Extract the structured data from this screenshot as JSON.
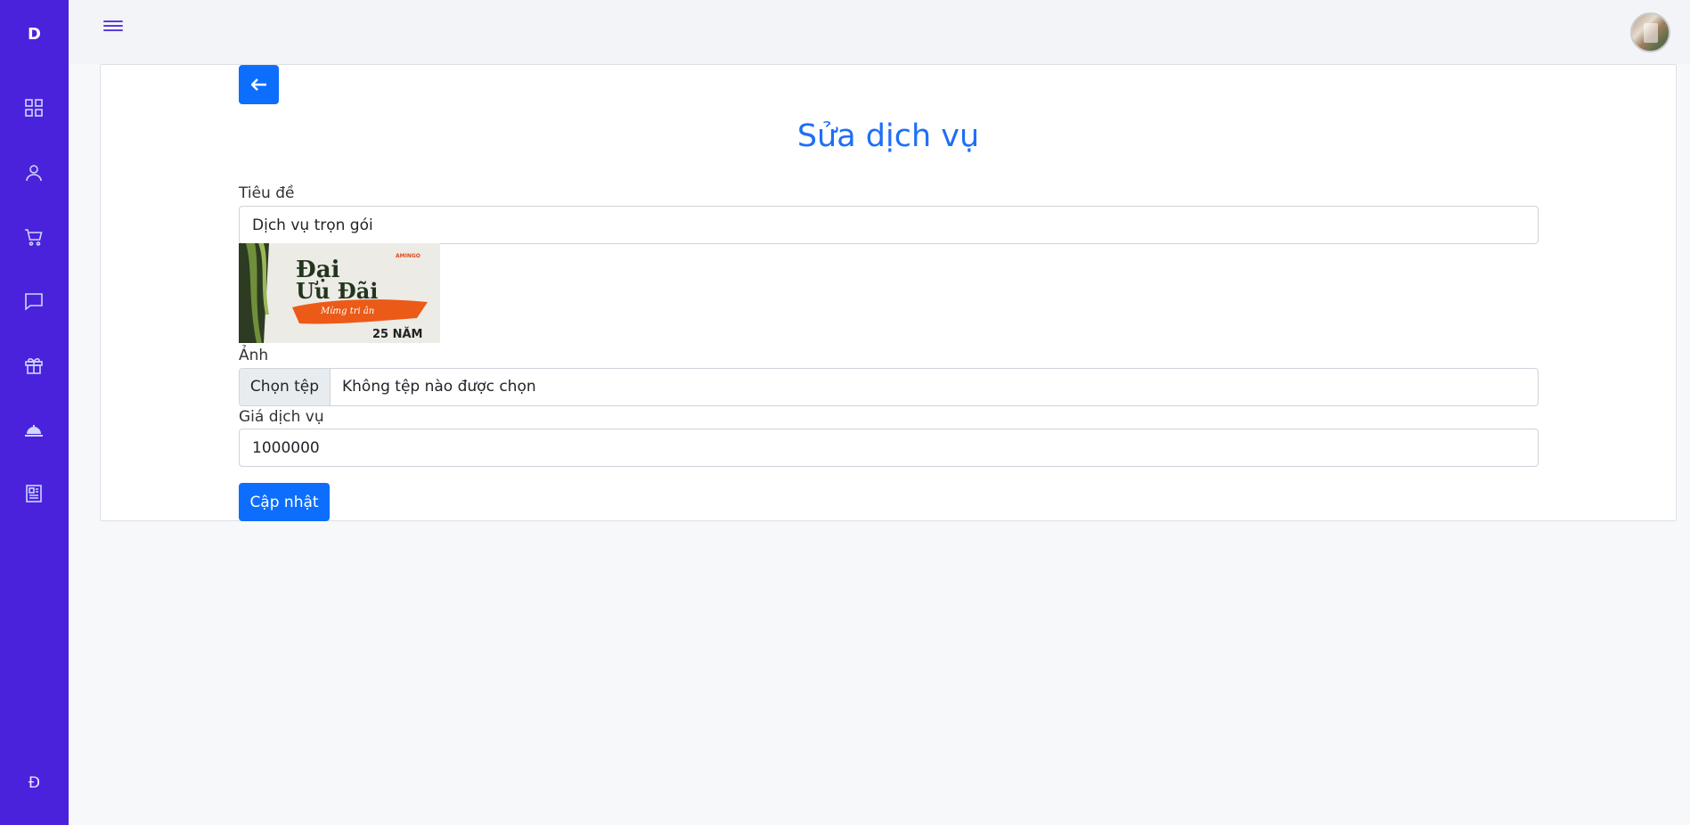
{
  "sidebar": {
    "brand": "D",
    "bottom_mark": "Đ",
    "items": [
      {
        "icon": "dashboard-grid-icon"
      },
      {
        "icon": "user-icon"
      },
      {
        "icon": "cart-icon"
      },
      {
        "icon": "message-icon"
      },
      {
        "icon": "gift-icon"
      },
      {
        "icon": "service-bell-icon"
      },
      {
        "icon": "newspaper-icon"
      }
    ]
  },
  "header": {
    "menu_icon": "hamburger-menu-icon",
    "avatar": "user-avatar"
  },
  "page": {
    "title": "Sửa dịch vụ",
    "back_icon": "arrow-left-icon"
  },
  "form": {
    "title_label": "Tiêu đề",
    "title_value": "Dịch vụ trọn gói",
    "image_label": "Ảnh",
    "image_preview_text": {
      "line1": "Đại",
      "line2": "Ưu Đãi",
      "script": "Mừng tri ân",
      "years": "25 NĂM",
      "brand": "AMINGO"
    },
    "file_button": "Chọn tệp",
    "file_status": "Không tệp nào được chọn",
    "price_label": "Giá dịch vụ",
    "price_value": "1000000",
    "submit": "Cập nhật"
  },
  "colors": {
    "sidebar": "#4a22dc",
    "primary": "#0d6efd",
    "title": "#1e6ff7"
  }
}
